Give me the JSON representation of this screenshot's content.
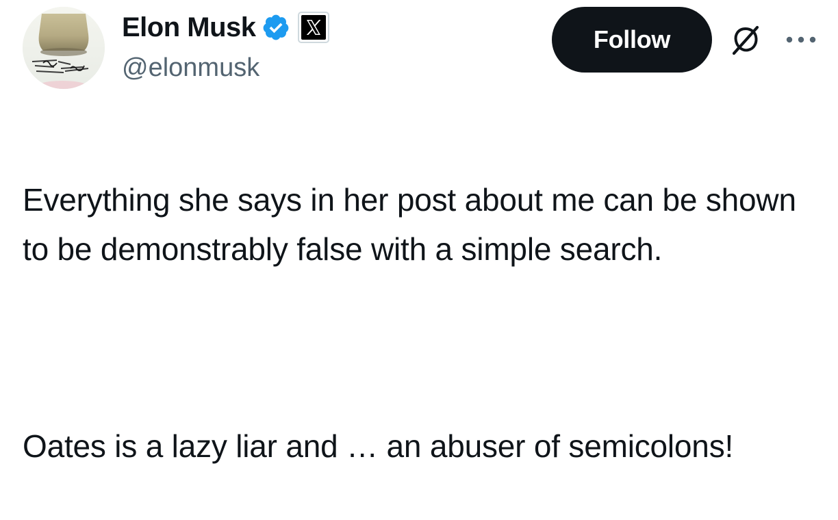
{
  "author": {
    "display_name": "Elon Musk",
    "handle": "@elonmusk",
    "verified_color": "#1d9bf0",
    "affiliation_icon": "x-logo-icon"
  },
  "actions": {
    "follow_label": "Follow",
    "grok_icon": "grok-slash-icon",
    "more_icon": "more-dots-icon"
  },
  "tweet": {
    "paragraph_1": "Everything she says in her post about me can be shown to be demonstrably false with a simple search.",
    "paragraph_2": "Oates is a lazy liar and … an abuser of semicolons!"
  }
}
